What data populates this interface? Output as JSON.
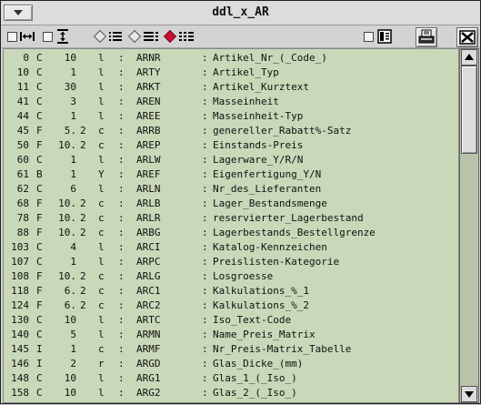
{
  "window": {
    "title": "ddl_x_AR"
  },
  "toolbar": {
    "icons": [
      "checkbox",
      "width-arrows-icon",
      "checkbox",
      "height-arrows-icon",
      "diamond",
      "list-icon",
      "diamond",
      "list-icon",
      "red-diamond",
      "grid-icon",
      "checkbox",
      "panel-icon",
      "printer-icon",
      "close-x-icon"
    ]
  },
  "rows": [
    {
      "offset": "0",
      "type": "C",
      "len": "10",
      "dec": "",
      "flag": "l",
      "key": "ARNR",
      "desc": "Artikel_Nr_(_Code_)"
    },
    {
      "offset": "10",
      "type": "C",
      "len": "1",
      "dec": "",
      "flag": "l",
      "key": "ARTY",
      "desc": "Artikel_Typ"
    },
    {
      "offset": "11",
      "type": "C",
      "len": "30",
      "dec": "",
      "flag": "l",
      "key": "ARKT",
      "desc": "Artikel_Kurztext"
    },
    {
      "offset": "41",
      "type": "C",
      "len": "3",
      "dec": "",
      "flag": "l",
      "key": "AREN",
      "desc": "Masseinheit"
    },
    {
      "offset": "44",
      "type": "C",
      "len": "1",
      "dec": "",
      "flag": "l",
      "key": "AREE",
      "desc": "Masseinheit-Typ"
    },
    {
      "offset": "45",
      "type": "F",
      "len": "5.",
      "dec": "2",
      "flag": "c",
      "key": "ARRB",
      "desc": "genereller_Rabatt%-Satz"
    },
    {
      "offset": "50",
      "type": "F",
      "len": "10.",
      "dec": "2",
      "flag": "c",
      "key": "AREP",
      "desc": "Einstands-Preis"
    },
    {
      "offset": "60",
      "type": "C",
      "len": "1",
      "dec": "",
      "flag": "l",
      "key": "ARLW",
      "desc": "Lagerware_Y/R/N"
    },
    {
      "offset": "61",
      "type": "B",
      "len": "1",
      "dec": "",
      "flag": "Y",
      "key": "AREF",
      "desc": "Eigenfertigung_Y/N"
    },
    {
      "offset": "62",
      "type": "C",
      "len": "6",
      "dec": "",
      "flag": "l",
      "key": "ARLN",
      "desc": "Nr_des_Lieferanten"
    },
    {
      "offset": "68",
      "type": "F",
      "len": "10.",
      "dec": "2",
      "flag": "c",
      "key": "ARLB",
      "desc": "Lager_Bestandsmenge"
    },
    {
      "offset": "78",
      "type": "F",
      "len": "10.",
      "dec": "2",
      "flag": "c",
      "key": "ARLR",
      "desc": "reservierter_Lagerbestand"
    },
    {
      "offset": "88",
      "type": "F",
      "len": "10.",
      "dec": "2",
      "flag": "c",
      "key": "ARBG",
      "desc": "Lagerbestands_Bestellgrenze"
    },
    {
      "offset": "103",
      "type": "C",
      "len": "4",
      "dec": "",
      "flag": "l",
      "key": "ARCI",
      "desc": "Katalog-Kennzeichen"
    },
    {
      "offset": "107",
      "type": "C",
      "len": "1",
      "dec": "",
      "flag": "l",
      "key": "ARPC",
      "desc": "Preislisten-Kategorie"
    },
    {
      "offset": "108",
      "type": "F",
      "len": "10.",
      "dec": "2",
      "flag": "c",
      "key": "ARLG",
      "desc": "Losgroesse"
    },
    {
      "offset": "118",
      "type": "F",
      "len": "6.",
      "dec": "2",
      "flag": "c",
      "key": "ARC1",
      "desc": "Kalkulations_%_1"
    },
    {
      "offset": "124",
      "type": "F",
      "len": "6.",
      "dec": "2",
      "flag": "c",
      "key": "ARC2",
      "desc": "Kalkulations_%_2"
    },
    {
      "offset": "130",
      "type": "C",
      "len": "10",
      "dec": "",
      "flag": "l",
      "key": "ARTC",
      "desc": "Iso_Text-Code"
    },
    {
      "offset": "140",
      "type": "C",
      "len": "5",
      "dec": "",
      "flag": "l",
      "key": "ARMN",
      "desc": "Name_Preis_Matrix"
    },
    {
      "offset": "145",
      "type": "I",
      "len": "1",
      "dec": "",
      "flag": "c",
      "key": "ARMF",
      "desc": "Nr_Preis-Matrix_Tabelle"
    },
    {
      "offset": "146",
      "type": "I",
      "len": "2",
      "dec": "",
      "flag": "r",
      "key": "ARGD",
      "desc": "Glas_Dicke_(mm)"
    },
    {
      "offset": "148",
      "type": "C",
      "len": "10",
      "dec": "",
      "flag": "l",
      "key": "ARG1",
      "desc": "Glas_1_(_Iso_)"
    },
    {
      "offset": "158",
      "type": "C",
      "len": "10",
      "dec": "",
      "flag": "l",
      "key": "ARG2",
      "desc": "Glas_2_(_Iso_)"
    }
  ],
  "separator": ":"
}
